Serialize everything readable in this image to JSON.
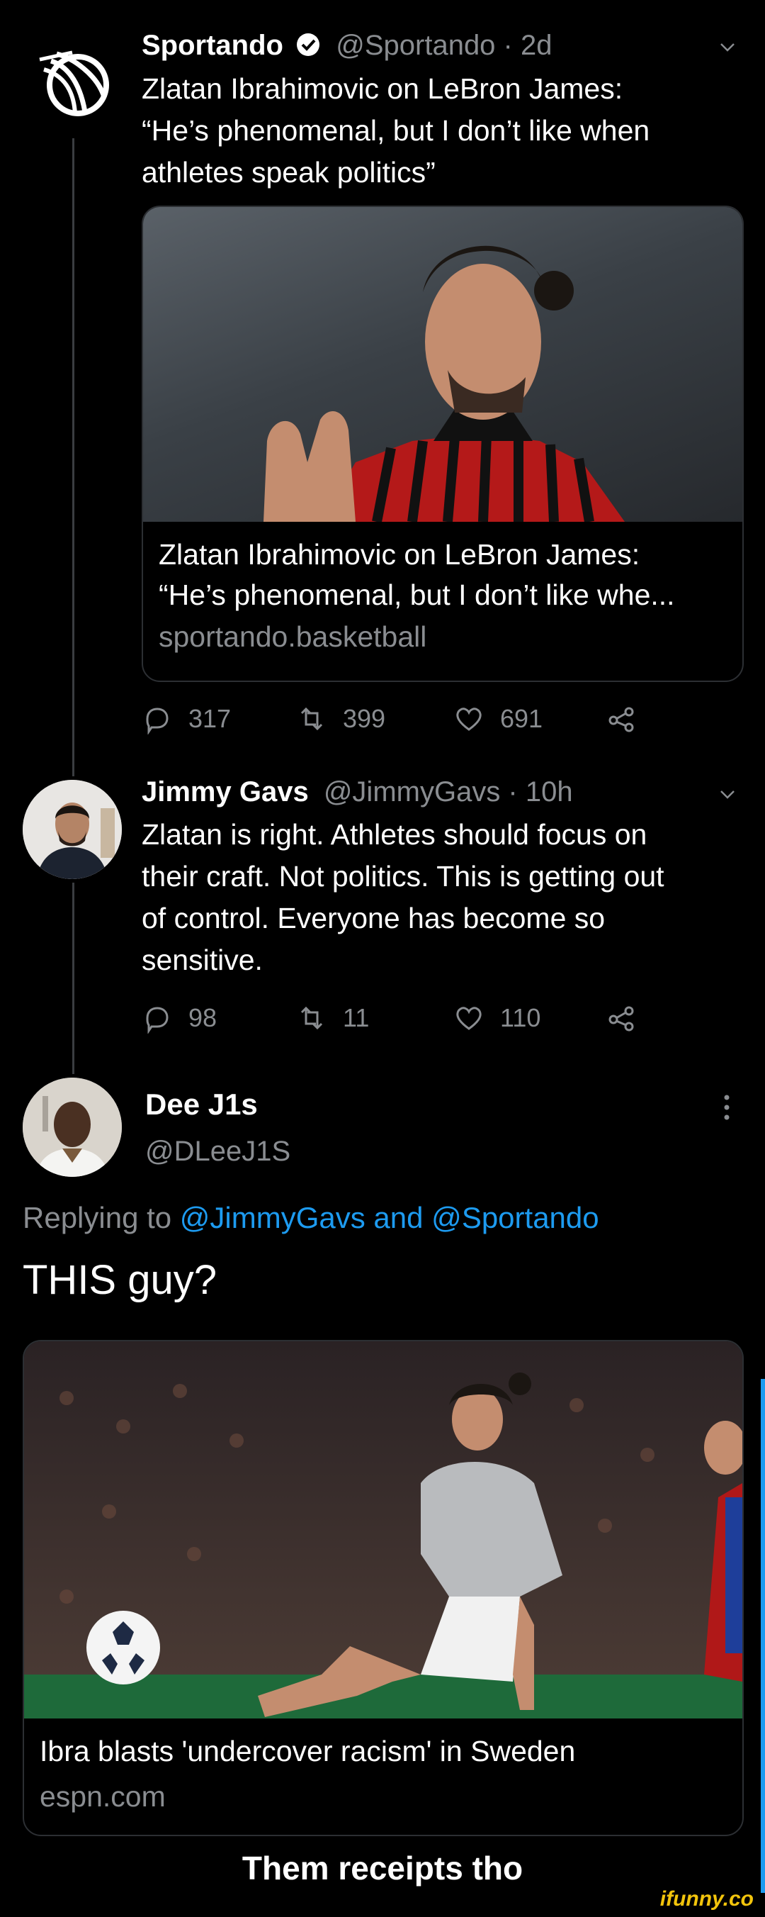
{
  "tweet1": {
    "name": "Sportando",
    "handle": "@Sportando · 2d",
    "text_lines": [
      "Zlatan Ibrahimovic on LeBron James:",
      "“He’s phenomenal, but I don’t like when",
      "athletes speak politics”"
    ],
    "card": {
      "title_lines": [
        "Zlatan Ibrahimovic on LeBron James:",
        "“He’s phenomenal, but I don’t like whe..."
      ],
      "domain": "sportando.basketball"
    },
    "actions": {
      "replies": "317",
      "retweets": "399",
      "likes": "691"
    }
  },
  "tweet2": {
    "name": "Jimmy Gavs",
    "handle": "@JimmyGavs · 10h",
    "text_lines": [
      "Zlatan is right. Athletes should focus on",
      "their craft. Not politics. This is getting out",
      "of control. Everyone has become so",
      "sensitive."
    ],
    "actions": {
      "replies": "98",
      "retweets": "11",
      "likes": "110"
    }
  },
  "tweet3": {
    "name": "Dee J1s",
    "handle": "@DLeeJ1S",
    "replying_prefix": "Replying to ",
    "replying_to": "@JimmyGavs and @Sportando",
    "text": "THIS guy?",
    "card": {
      "title": "Ibra blasts 'undercover racism' in Sweden",
      "domain": "espn.com"
    }
  },
  "caption": "Them receipts tho",
  "watermark": "ifunny.co",
  "colors": {
    "background": "#000000",
    "accent": "#1d9bf0",
    "muted": "#8a8d91",
    "watermark": "#f2c40c"
  }
}
